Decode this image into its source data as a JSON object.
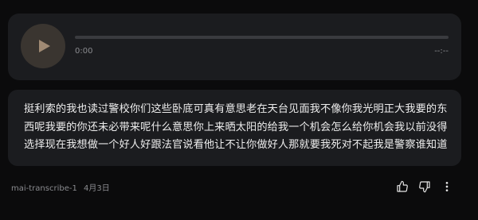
{
  "audio": {
    "time_current": "0:00",
    "time_total": "--:--",
    "progress": 0,
    "play_icon": "play-icon",
    "accent_color": "#a08a74"
  },
  "transcript": {
    "lines": [
      "挺利索的我也读过警校你们这些卧底可真有意思老在天台见面我不像你我光明正大我要的东",
      "西呢我要的你还未必带来呢什么意思你上来晒太阳的给我一个机会怎么给你机会我以前没得",
      "选择现在我想做一个好人好跟法官说看他让不让你做好人那就要我死对不起我是警察谁知道"
    ]
  },
  "footer": {
    "model": "mai-transcribe-1",
    "date": "4月3日",
    "icons": [
      "thumbs-up-icon",
      "thumbs-down-icon",
      "more-options-icon"
    ]
  }
}
